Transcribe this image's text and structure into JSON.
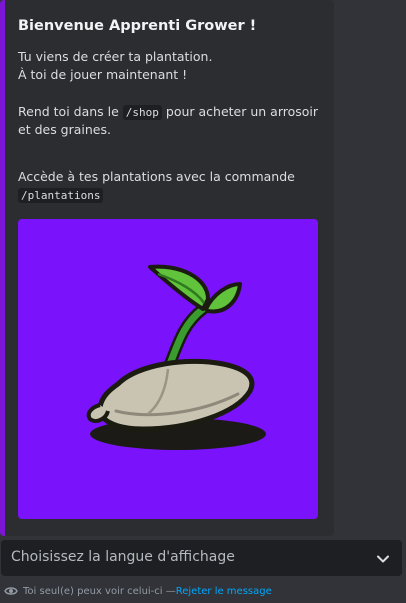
{
  "embed": {
    "accent_color": "#7b16d6",
    "title": "Bienvenue Apprenti Grower !",
    "line1": "Tu viens de créer ta plantation.",
    "line2": "À toi de jouer maintenant !",
    "line3_prefix": "Rend toi dans le ",
    "line3_code": "/shop",
    "line3_suffix": " pour acheter un arrosoir",
    "line4": "et des graines.",
    "line5": "Accède à tes plantations avec la commande",
    "line6_code": "/plantations",
    "image": {
      "background": "#7a13fb",
      "icon": "seed-sprout-icon"
    }
  },
  "language_select": {
    "placeholder": "Choisissez la langue d'affichage",
    "icon": "chevron-down-icon"
  },
  "footer": {
    "icon": "eye-icon",
    "text": "Toi seul(e) peux voir celui-ci — ",
    "dismiss_label": "Rejeter le message",
    "dismiss_color": "#00a8fc"
  }
}
